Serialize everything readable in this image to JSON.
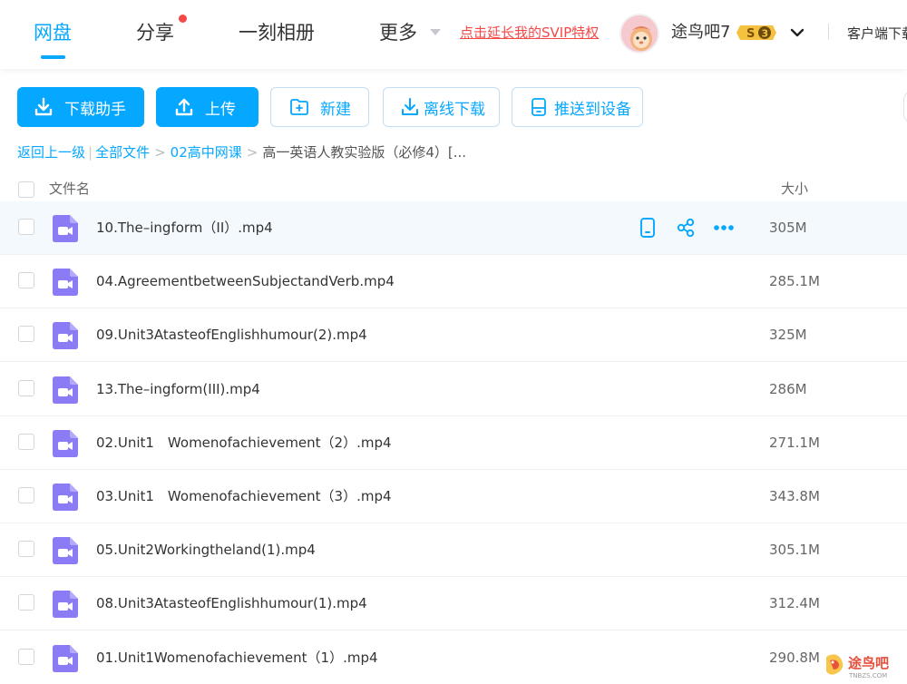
{
  "nav": {
    "items": [
      {
        "label": "网盘",
        "active": true
      },
      {
        "label": "分享"
      },
      {
        "label": "一刻相册"
      },
      {
        "label": "更多"
      }
    ],
    "svip_promo": "点击延长我的SVIP特权",
    "username": "途鸟吧7",
    "badge_level": "3",
    "client_link": "客户端下载"
  },
  "toolbar": {
    "download_helper": "下载助手",
    "upload": "上传",
    "new": "新建",
    "offline_download": "离线下载",
    "push_to_device": "推送到设备"
  },
  "breadcrumb": {
    "back": "返回上一级",
    "separator": "|",
    "items": [
      "全部文件",
      "02高中网课"
    ],
    "current": "高一英语人教实验版（必修4）[..."
  },
  "table": {
    "headers": {
      "name": "文件名",
      "size": "大小"
    },
    "rows": [
      {
        "name": "10.The–ingform（II）.mp4",
        "size": "305M",
        "hovered": true
      },
      {
        "name": "04.AgreementbetweenSubjectandVerb.mp4",
        "size": "285.1M"
      },
      {
        "name": "09.Unit3AtasteofEnglishhumour(2).mp4",
        "size": "325M"
      },
      {
        "name": "13.The–ingform(III).mp4",
        "size": "286M"
      },
      {
        "name": "02.Unit1　Womenofachievement（2）.mp4",
        "size": "271.1M"
      },
      {
        "name": "03.Unit1　Womenofachievement（3）.mp4",
        "size": "343.8M"
      },
      {
        "name": "05.Unit2Workingtheland(1).mp4",
        "size": "305.1M"
      },
      {
        "name": "08.Unit3AtasteofEnglishhumour(1).mp4",
        "size": "312.4M"
      },
      {
        "name": "01.Unit1Womenofachievement（1）.mp4",
        "size": "290.8M"
      }
    ]
  },
  "watermark": {
    "text": "途鸟吧",
    "sub": "TNBZS.COM"
  },
  "colors": {
    "accent": "#06a7ff",
    "promo_red": "#f54848",
    "video_icon": "#8b7cf6",
    "badge_gold": "#f4c23e"
  },
  "icons": {
    "download_helper": "download-icon",
    "upload": "upload-icon",
    "new": "new-folder-icon",
    "offline_download": "download-icon",
    "push_to_device": "device-icon",
    "row_push": "phone-icon",
    "row_share": "share-icon",
    "row_more": "more-icon",
    "file_type": "video-file-icon"
  }
}
